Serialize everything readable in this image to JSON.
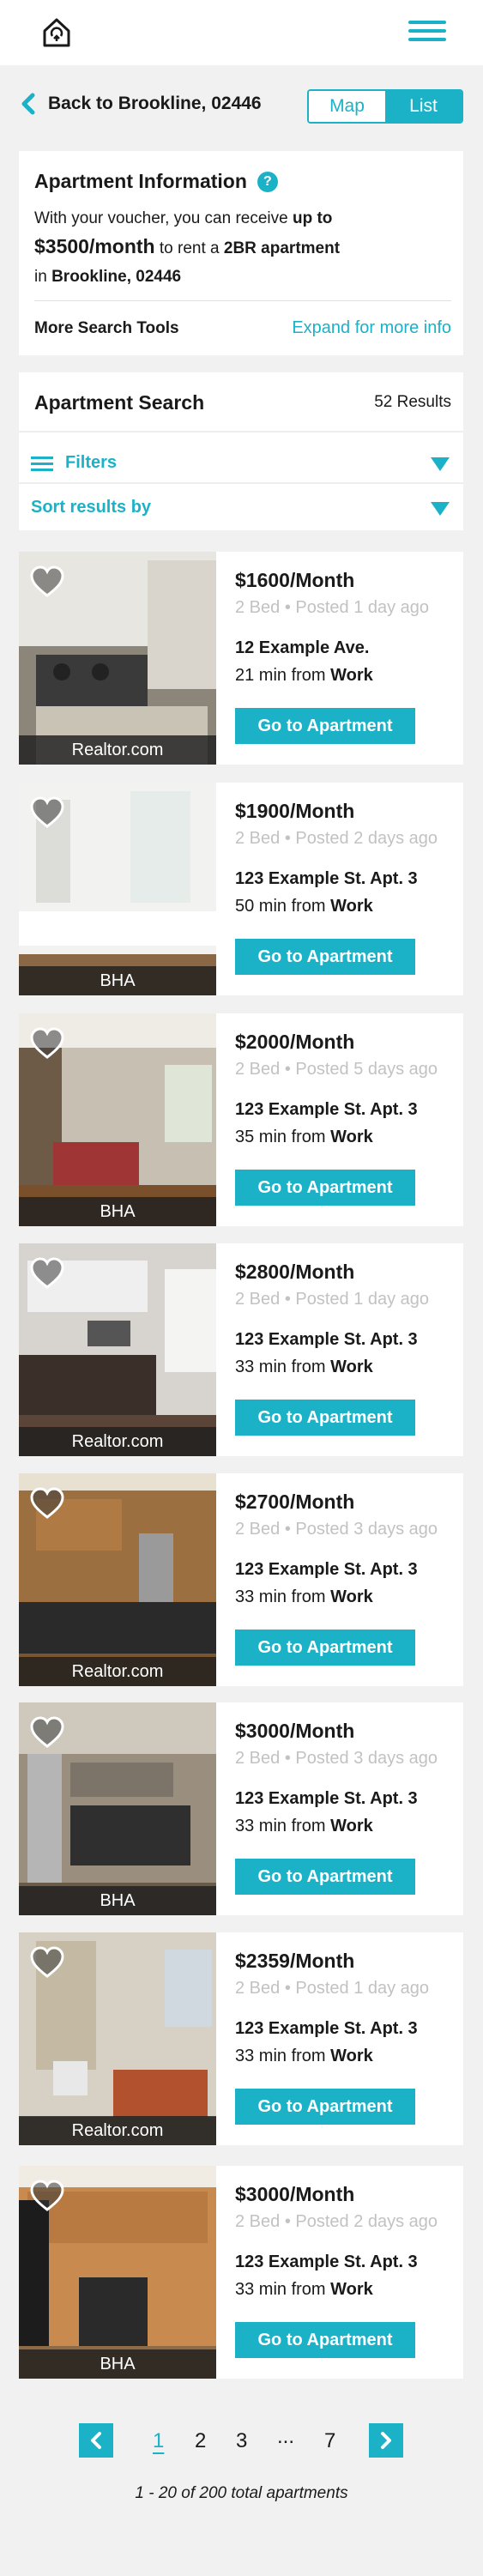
{
  "nav": {
    "home_icon": "home-icon",
    "menu_icon": "hamburger-menu-icon"
  },
  "back": {
    "label": "Back to Brookline, 02446"
  },
  "view_toggle": {
    "map": "Map",
    "list": "List",
    "selected": "List"
  },
  "info": {
    "title": "Apartment Information",
    "line1": "With your voucher, you can receive",
    "line1_bold": "up to",
    "amount": "$3500/month",
    "line2_mid": "to rent a",
    "unit_type": "2BR apartment",
    "line3_pre": "in",
    "location": "Brookline, 02446",
    "more_tools": "More Search Tools",
    "expand": "Expand for more info"
  },
  "search": {
    "title": "Apartment Search",
    "result_count": "52 Results",
    "filters_label": "Filters",
    "sort_label": "Sort results by"
  },
  "listings": [
    {
      "price": "$1600/Month",
      "meta": "2 Bed • Posted 1 day ago",
      "address": "12 Example Ave.",
      "commute": "21 min from",
      "commute_dest": "Work",
      "source": "Realtor.com",
      "button": "Go to Apartment"
    },
    {
      "price": "$1900/Month",
      "meta": "2 Bed • Posted 2 days ago",
      "address": "123 Example St. Apt. 3",
      "commute": "50 min from",
      "commute_dest": "Work",
      "source": "BHA",
      "button": "Go to Apartment"
    },
    {
      "price": "$2000/Month",
      "meta": "2 Bed • Posted 5 days ago",
      "address": "123 Example St. Apt. 3",
      "commute": "35 min from",
      "commute_dest": "Work",
      "source": "BHA",
      "button": "Go to Apartment"
    },
    {
      "price": "$2800/Month",
      "meta": "2 Bed • Posted 1 day ago",
      "address": "123 Example St. Apt. 3",
      "commute": "33 min from",
      "commute_dest": "Work",
      "source": "Realtor.com",
      "button": "Go to Apartment"
    },
    {
      "price": "$2700/Month",
      "meta": "2 Bed • Posted 3 days ago",
      "address": "123 Example St. Apt. 3",
      "commute": "33 min from",
      "commute_dest": "Work",
      "source": "Realtor.com",
      "button": "Go to Apartment"
    },
    {
      "price": "$3000/Month",
      "meta": "2 Bed • Posted 3 days ago",
      "address": "123 Example St. Apt. 3",
      "commute": "33 min from",
      "commute_dest": "Work",
      "source": "BHA",
      "button": "Go to Apartment"
    },
    {
      "price": "$2359/Month",
      "meta": "2 Bed • Posted 1 day ago",
      "address": "123 Example St. Apt. 3",
      "commute": "33 min from",
      "commute_dest": "Work",
      "source": "Realtor.com",
      "button": "Go to Apartment"
    },
    {
      "price": "$3000/Month",
      "meta": "2 Bed • Posted 2 days ago",
      "address": "123 Example St. Apt. 3",
      "commute": "33 min from",
      "commute_dest": "Work",
      "source": "BHA",
      "button": "Go to Apartment"
    }
  ],
  "pagination": {
    "pages": [
      "1",
      "2",
      "3",
      "...",
      "7"
    ],
    "current": "1",
    "summary": "1 - 20 of 200 total apartments"
  },
  "colors": {
    "accent": "#1bb2c8",
    "background": "#f1f1f1"
  }
}
